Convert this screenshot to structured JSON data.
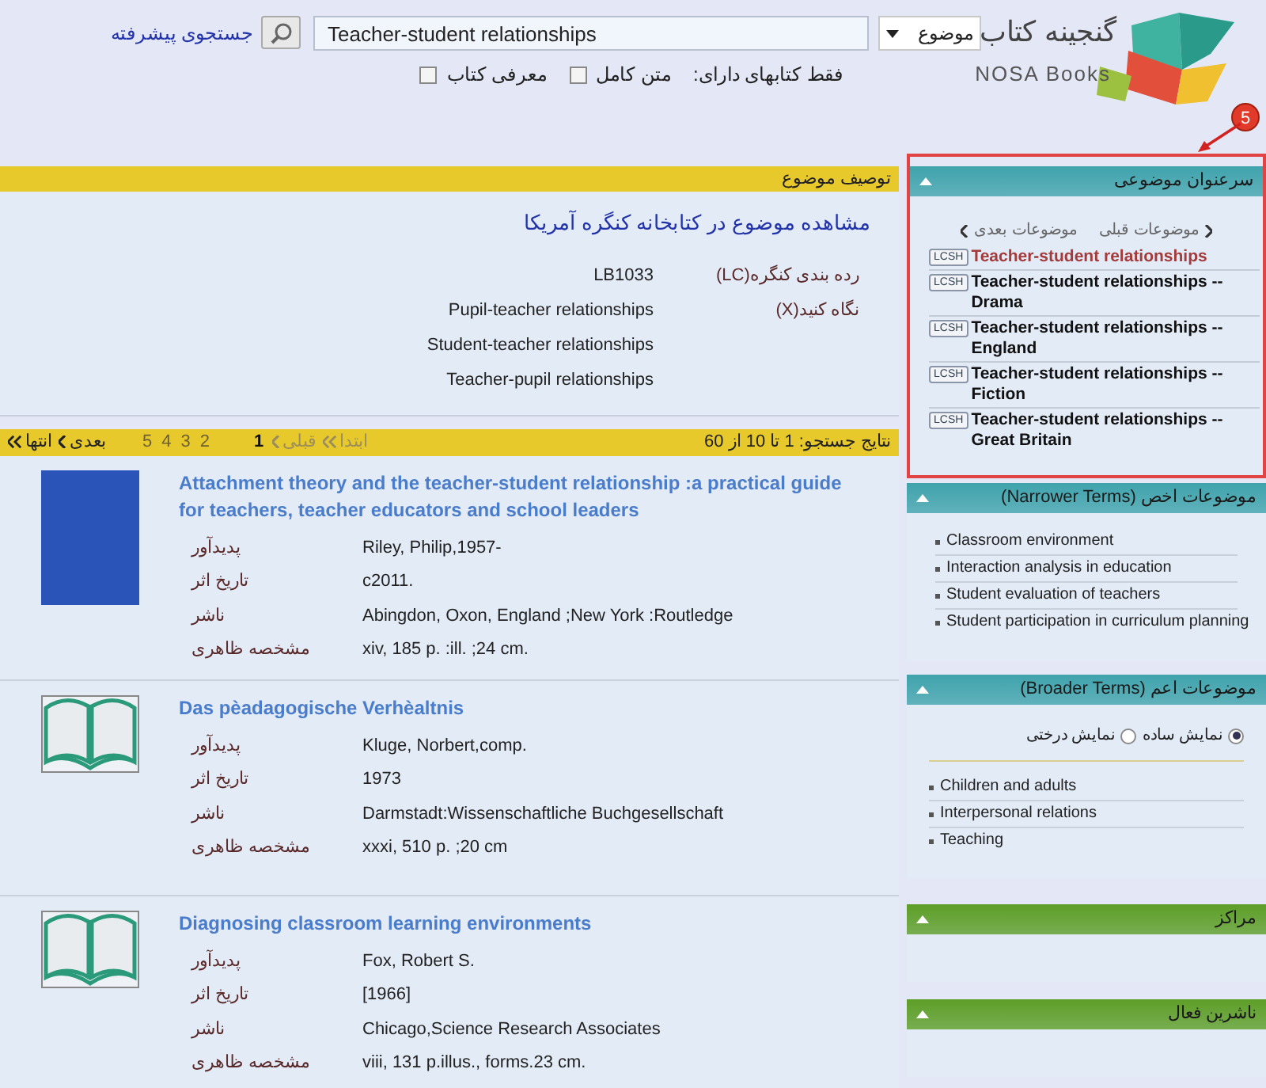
{
  "header": {
    "logo": {
      "title": "گنجینه کتاب",
      "subtitle": "NOSA Books"
    },
    "search_type": "موضوع",
    "search_value": "Teacher-student relationships",
    "advanced_search": "جستجوی پیشرفته",
    "filter_label": "فقط کتابهای دارای:",
    "filters": [
      {
        "label": "متن کامل",
        "checked": false
      },
      {
        "label": "معرفی کتاب",
        "checked": false
      }
    ]
  },
  "annotation": {
    "number": "5"
  },
  "subject_description": {
    "title": "توصیف موضوع",
    "link": "مشاهده موضوع در کتابخانه کنگره آمریکا",
    "fields": [
      {
        "label": "رده بندی کنگره(LC)",
        "values": [
          "LB1033"
        ]
      },
      {
        "label": "نگاه کنید(X)",
        "values": [
          "Pupil-teacher relationships",
          "Student-teacher relationships",
          "Teacher-pupil relationships"
        ]
      }
    ]
  },
  "results": {
    "summary": "نتایج جستجو: 1 تا 10 از 60",
    "pager": [
      {
        "label": "ابتدا",
        "kind": "first",
        "disabled": true
      },
      {
        "label": "قبلی",
        "kind": "prev",
        "disabled": true
      },
      {
        "label": "1",
        "kind": "page",
        "selected": true
      },
      {
        "label": "2",
        "kind": "page",
        "selected": false
      },
      {
        "label": "3",
        "kind": "page",
        "selected": false
      },
      {
        "label": "4",
        "kind": "page",
        "selected": false
      },
      {
        "label": "5",
        "kind": "page",
        "selected": false
      },
      {
        "label": "بعدی",
        "kind": "next",
        "disabled": false
      },
      {
        "label": "انتها",
        "kind": "last",
        "disabled": false
      }
    ],
    "records": [
      {
        "kind": "photo",
        "title": "Attachment theory and the teacher-student relationship :a practical guide for teachers, teacher educators and school leaders",
        "fields": [
          {
            "label": "پدیدآور",
            "value": "Riley, Philip,1957-"
          },
          {
            "label": "تاریخ اثر",
            "value": "c2011."
          },
          {
            "label": "ناشر",
            "value": "Abingdon, Oxon, England ;New York :Routledge"
          },
          {
            "label": "مشخصه ظاهری",
            "value": "xiv, 185 p. :ill. ;24 cm."
          }
        ]
      },
      {
        "kind": "book",
        "title": "Das pèadagogische Verhèaltnis",
        "fields": [
          {
            "label": "پدیدآور",
            "value": "Kluge, Norbert,comp."
          },
          {
            "label": "تاریخ اثر",
            "value": "1973"
          },
          {
            "label": "ناشر",
            "value": "Darmstadt:Wissenschaftliche Buchgesellschaft"
          },
          {
            "label": "مشخصه ظاهری",
            "value": "xxxi, 510 p. ;20 cm"
          }
        ]
      },
      {
        "kind": "book",
        "title": "Diagnosing classroom learning environments",
        "fields": [
          {
            "label": "پدیدآور",
            "value": "Fox, Robert S."
          },
          {
            "label": "تاریخ اثر",
            "value": "[1966]"
          },
          {
            "label": "ناشر",
            "value": "Chicago,Science Research Associates"
          },
          {
            "label": "مشخصه ظاهری",
            "value": "viii, 131 p.illus., forms.23 cm."
          }
        ]
      }
    ]
  },
  "sidebar": [
    {
      "kind": "headings",
      "title": "سرعنوان موضوعی",
      "color": "#3fa3ac",
      "highlighted": true,
      "prev": "موضوعات قبلی",
      "next": "موضوعات بعدی",
      "items": [
        {
          "badge": "LCSH",
          "text": "Teacher-student relationships",
          "selected": true
        },
        {
          "badge": "LCSH",
          "text": "Teacher-student relationships -- Drama",
          "selected": false
        },
        {
          "badge": "LCSH",
          "text": "Teacher-student relationships -- England",
          "selected": false
        },
        {
          "badge": "LCSH",
          "text": "Teacher-student relationships -- Fiction",
          "selected": false
        },
        {
          "badge": "LCSH",
          "text": "Teacher-student relationships -- Great Britain",
          "selected": false
        }
      ]
    },
    {
      "kind": "terms",
      "title": "موضوعات اخص (Narrower Terms)",
      "color": "#3fa3ac",
      "highlighted": false,
      "items": [
        "Classroom environment",
        "Interaction analysis in education",
        "Student evaluation of teachers",
        "Student participation in curriculum planning"
      ]
    },
    {
      "kind": "broader",
      "title": "موضوعات اعم (Broader Terms)",
      "color": "#3fa3ac",
      "highlighted": false,
      "radios": [
        {
          "label": "نمایش ساده",
          "selected": true
        },
        {
          "label": "نمایش درختی",
          "selected": false
        }
      ],
      "items": [
        "Children and adults",
        "Interpersonal relations",
        "Teaching"
      ]
    },
    {
      "kind": "empty",
      "title": "مراکز",
      "color": "#5d9e27",
      "highlighted": false
    },
    {
      "kind": "empty",
      "title": "ناشرین فعال",
      "color": "#5d9e27",
      "highlighted": false
    }
  ]
}
